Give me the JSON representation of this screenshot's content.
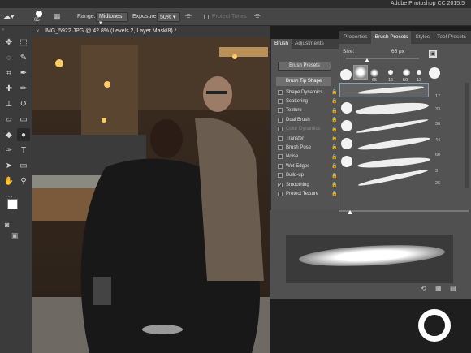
{
  "titlebar": {
    "app_title": "Adobe Photoshop CC 2015.5"
  },
  "options": {
    "brush_size": "65",
    "range_label": "Range:",
    "range_value": "Midtones",
    "exposure_label": "Exposure:",
    "exposure_value": "50%",
    "protect_tones": "Protect Tones"
  },
  "document": {
    "tab_title": "IMG_5922.JPG @ 42.8% (Levels 2, Layer Mask/8) *"
  },
  "brush_panel": {
    "tabs": [
      "Brush",
      "Adjustments"
    ],
    "presets_button": "Brush Presets",
    "tip_shape_button": "Brush Tip Shape",
    "options": [
      {
        "label": "Shape Dynamics",
        "checked": false,
        "dim": false
      },
      {
        "label": "Scattering",
        "checked": false,
        "dim": false
      },
      {
        "label": "Texture",
        "checked": false,
        "dim": false
      },
      {
        "label": "Dual Brush",
        "checked": false,
        "dim": false
      },
      {
        "label": "Color Dynamics",
        "checked": false,
        "dim": true
      },
      {
        "label": "Transfer",
        "checked": false,
        "dim": false
      },
      {
        "label": "Brush Pose",
        "checked": false,
        "dim": false
      },
      {
        "label": "Noise",
        "checked": false,
        "dim": false
      },
      {
        "label": "Wet Edges",
        "checked": false,
        "dim": false
      },
      {
        "label": "Build-up",
        "checked": false,
        "dim": false
      },
      {
        "label": "Smoothing",
        "checked": true,
        "dim": false
      },
      {
        "label": "Protect Texture",
        "checked": false,
        "dim": false
      }
    ]
  },
  "presets_panel": {
    "tabs": [
      "Properties",
      "Brush Presets",
      "Styles",
      "Tool Presets"
    ],
    "size_label": "Size:",
    "size_value": "65 px",
    "tip_sizes": [
      "65",
      "16",
      "50",
      "13"
    ],
    "side_numbers": [
      "17",
      "33",
      "36",
      "44",
      "60",
      "3",
      "26"
    ]
  }
}
